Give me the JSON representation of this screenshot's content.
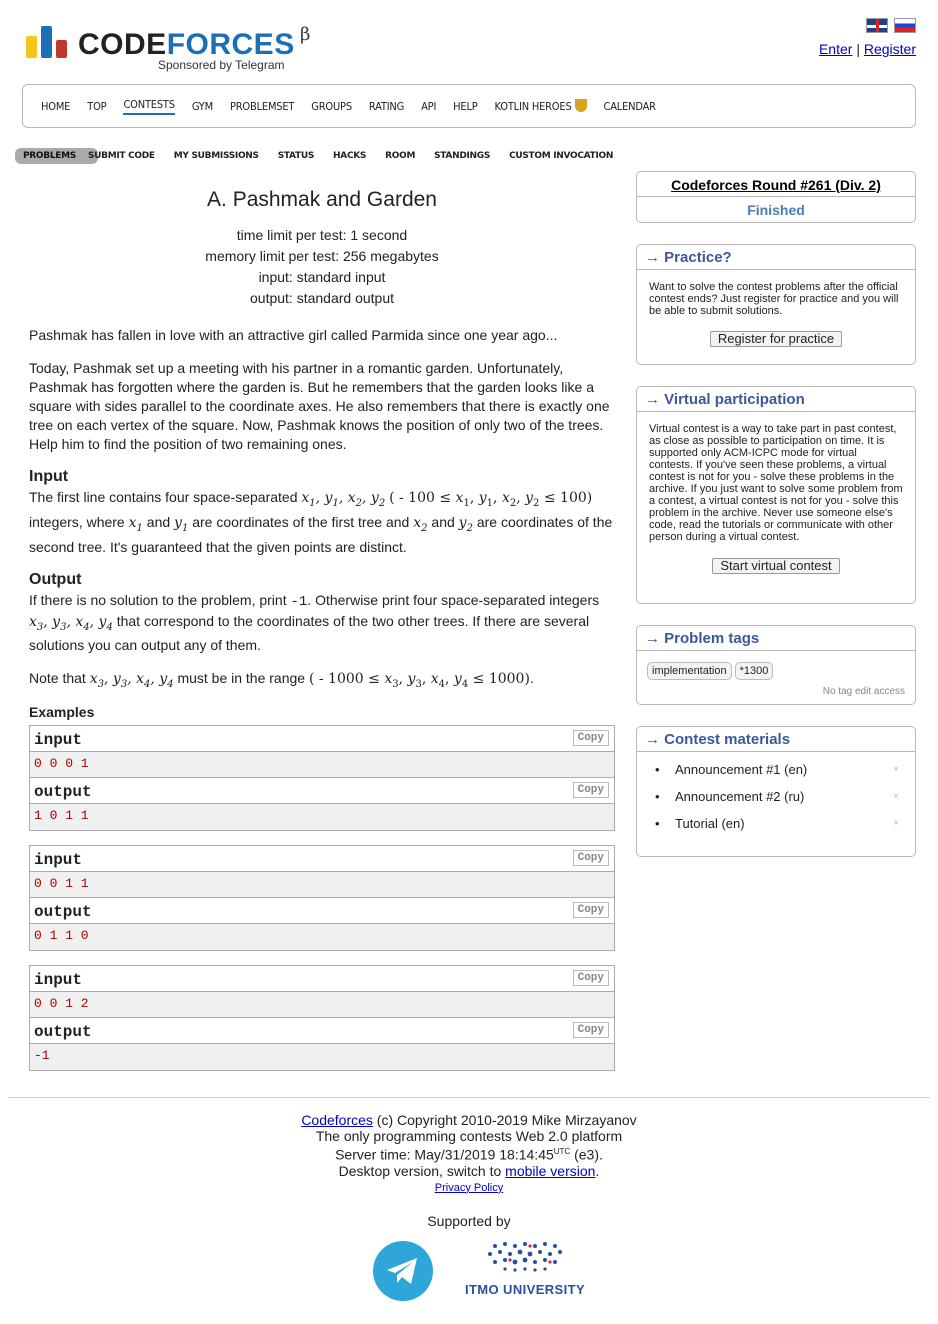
{
  "header": {
    "logo_word_a": "CODE",
    "logo_word_b": "FORCES",
    "beta": "β",
    "sponsor": "Sponsored by Telegram",
    "enter": "Enter",
    "separator": "|",
    "register": "Register",
    "flags": [
      "english-flag",
      "russian-flag"
    ]
  },
  "menu": [
    {
      "label": "Home"
    },
    {
      "label": "Top"
    },
    {
      "label": "Contests"
    },
    {
      "label": "Gym"
    },
    {
      "label": "Problemset"
    },
    {
      "label": "Groups"
    },
    {
      "label": "Rating"
    },
    {
      "label": "API"
    },
    {
      "label": "Help"
    },
    {
      "label": "Kotlin Heroes"
    },
    {
      "label": "Calendar"
    }
  ],
  "active_menu": "Contests",
  "submenu": [
    "Problems",
    "Submit Code",
    "My Submissions",
    "Status",
    "Hacks",
    "Room",
    "Standings",
    "Custom Invocation"
  ],
  "problem": {
    "title": "A. Pashmak and Garden",
    "time_limit": "time limit per test: 1 second",
    "memory_limit": "memory limit per test: 256 megabytes",
    "input_file": "input: standard input",
    "output_file": "output: standard output",
    "intro": "Pashmak has fallen in love with an attractive girl called Parmida since one year ago...",
    "legend": "Today, Pashmak set up a meeting with his partner in a romantic garden. Unfortunately, Pashmak has forgotten where the garden is. But he remembers that the garden looks like a square with sides parallel to the coordinate axes. He also remembers that there is exactly one tree on each vertex of the square. Now, Pashmak knows the position of only two of the trees. Help him to find the position of two remaining ones.",
    "input_title": "Input",
    "input_a": "The first line contains four space-separated",
    "input_b": "integers, where",
    "input_c": "and",
    "input_d": "are coordinates of the first tree and",
    "input_e": "and",
    "input_f": "are coordinates of the second tree. It's guaranteed that the given points are distinct.",
    "output_title": "Output",
    "output_a": "If there is no solution to the problem, print",
    "output_code": "-1",
    "output_b": ". Otherwise print four space-separated integers",
    "output_c": "that correspond to the coordinates of the two other trees. If there are several solutions you can output any of them.",
    "note_a": "Note that",
    "note_b": "must be in the range",
    "note_c": ".",
    "examples_title": "Examples",
    "input_label": "input",
    "output_label": "output",
    "copy_label": "Copy",
    "examples": [
      {
        "input": "0 0 0 1",
        "output": "1 0 1 1"
      },
      {
        "input": "0 0 1 1",
        "output": "0 1 1 0"
      },
      {
        "input": "0 0 1 2",
        "output": "-1"
      }
    ]
  },
  "sidebar": {
    "round_name": "Codeforces Round #261 (Div. 2)",
    "round_status": "Finished",
    "arrow": "→",
    "practice_title": "Practice?",
    "practice_text": "Want to solve the contest problems after the official contest ends? Just register for practice and you will be able to submit solutions.",
    "practice_button": "Register for practice",
    "virtual_title": "Virtual participation",
    "virtual_text": "Virtual contest is a way to take part in past contest, as close as possible to participation on time. It is supported only ACM-ICPC mode for virtual contests. If you've seen these problems, a virtual contest is not for you - solve these problems in the archive. If you just want to solve some problem from a contest, a virtual contest is not for you - solve this problem in the archive. Never use someone else's code, read the tutorials or communicate with other person during a virtual contest.",
    "virtual_button": "Start virtual contest",
    "tags_title": "Problem tags",
    "tags": [
      "implementation",
      "*1300"
    ],
    "tags_note": "No tag edit access",
    "materials_title": "Contest materials",
    "materials": [
      "Announcement #1 (en)",
      "Announcement #2 (ru)",
      "Tutorial (en)"
    ],
    "material_remove": "×"
  },
  "footer": {
    "site": "Codeforces",
    "copyright": "(c) Copyright 2010-2019 Mike Mirzayanov",
    "tagline": "The only programming contests Web 2.0 platform",
    "server_time_label": "Server time: May/31/2019 18:14:45",
    "utc": "UTC",
    "server_suffix": "(e3).",
    "desktop_text": "Desktop version, switch to",
    "mobile_link": "mobile version",
    "dot": ".",
    "privacy": "Privacy Policy",
    "supported_by": "Supported by",
    "itmo": "ITMO UNIVERSITY"
  },
  "colors": {
    "logo_yellow": "#f5c518",
    "logo_blue": "#1a6fb5",
    "logo_red": "#c0392b",
    "sidebar_title": "#3b5998",
    "sample_text": "#aa0000",
    "telegram": "#2ea6da"
  }
}
